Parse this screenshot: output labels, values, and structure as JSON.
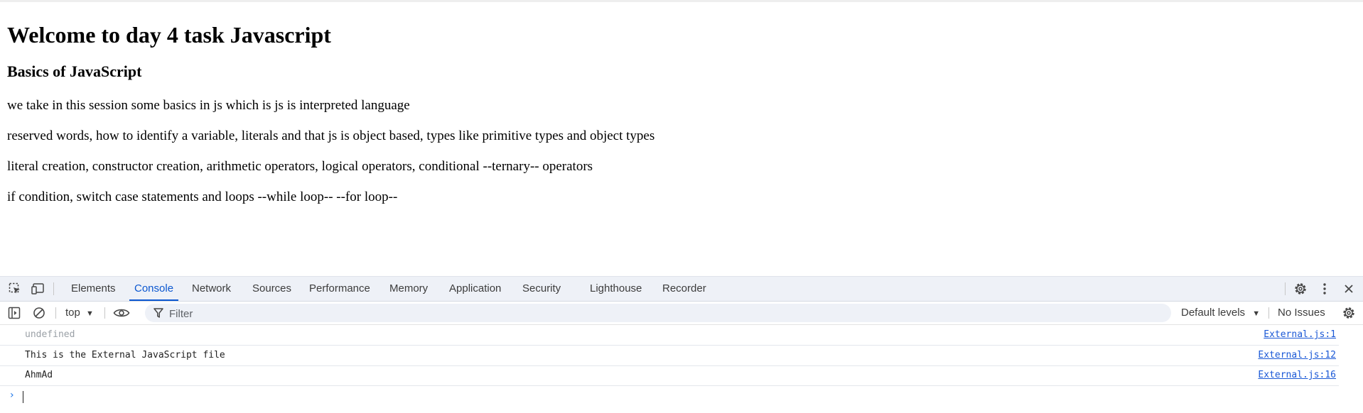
{
  "page": {
    "heading": "Welcome to day 4 task Javascript",
    "subheading": "Basics of JavaScript",
    "paragraphs": [
      "we take in this session some basics in js which is js is interpreted language",
      "reserved words, how to identify a variable, literals and that js is object based, types like primitive types and object types",
      "literal creation, constructor creation, arithmetic operators, logical operators, conditional --ternary-- operators",
      "if condition, switch case statements and loops --while loop-- --for loop--"
    ]
  },
  "devtools": {
    "tabs": [
      {
        "label": "Elements",
        "active": false
      },
      {
        "label": "Console",
        "active": true
      },
      {
        "label": "Network",
        "active": false
      },
      {
        "label": "Sources",
        "active": false
      },
      {
        "label": "Performance",
        "active": false
      },
      {
        "label": "Memory",
        "active": false
      },
      {
        "label": "Application",
        "active": false
      },
      {
        "label": "Security",
        "active": false
      },
      {
        "label": "Lighthouse",
        "active": false
      },
      {
        "label": "Recorder",
        "active": false
      }
    ],
    "toolbar": {
      "context": "top",
      "filter_placeholder": "Filter",
      "levels": "Default levels",
      "issues": "No Issues"
    },
    "logs": [
      {
        "message": "undefined",
        "source": "External.js:1",
        "dim": true
      },
      {
        "message": "This is the External JavaScript file",
        "source": "External.js:12",
        "dim": false
      },
      {
        "message": "AhmAd",
        "source": "External.js:16",
        "dim": false
      }
    ]
  },
  "colors": {
    "accent": "#0b57d0",
    "link": "#1a58d6",
    "tabbar_bg": "#eef1f7"
  }
}
